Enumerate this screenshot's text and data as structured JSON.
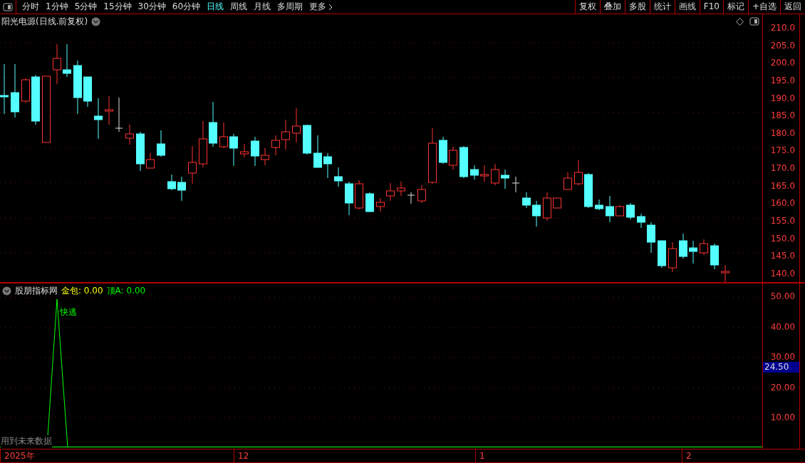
{
  "toolbar": {
    "periods": [
      {
        "label": "分时",
        "selected": false,
        "kind": "plain"
      },
      {
        "label": "1分钟",
        "selected": false,
        "kind": "plain"
      },
      {
        "label": "5分钟",
        "selected": false,
        "kind": "plain"
      },
      {
        "label": "15分钟",
        "selected": false,
        "kind": "plain"
      },
      {
        "label": "30分钟",
        "selected": false,
        "kind": "plain"
      },
      {
        "label": "60分钟",
        "selected": false,
        "kind": "plain"
      },
      {
        "label": "日线",
        "selected": true,
        "kind": "plain"
      },
      {
        "label": "周线",
        "selected": false,
        "kind": "plain"
      },
      {
        "label": "月线",
        "selected": false,
        "kind": "plain"
      },
      {
        "label": "多周期",
        "selected": false,
        "kind": "plain"
      },
      {
        "label": "更多",
        "selected": false,
        "kind": "menu"
      }
    ],
    "actions": [
      "复权",
      "叠加",
      "多股",
      "统计",
      "画线",
      "F10",
      "标记",
      "+自选",
      "返回"
    ]
  },
  "main_chart": {
    "title": "阳光电源(日线.前复权)",
    "price_ticks": [
      "210.0",
      "205.0",
      "200.0",
      "195.0",
      "190.0",
      "185.0",
      "180.0",
      "175.0",
      "170.0",
      "165.0",
      "160.0",
      "155.0",
      "150.0",
      "145.0",
      "140.0"
    ]
  },
  "indicator": {
    "name": "股朋指标网",
    "readings": [
      {
        "label": "金包:",
        "value": "0.00",
        "color": "#ffff00"
      },
      {
        "label": "顶A:",
        "value": "0.00",
        "color": "#00ff00"
      }
    ],
    "signal_label": "快逃",
    "ticks": [
      "50.00",
      "40.00",
      "30.00",
      "20.00",
      "10.00"
    ],
    "current_value": "24.50",
    "note": "用到未来数据"
  },
  "date_axis": [
    "2025年",
    "12",
    "1",
    "2"
  ]
}
